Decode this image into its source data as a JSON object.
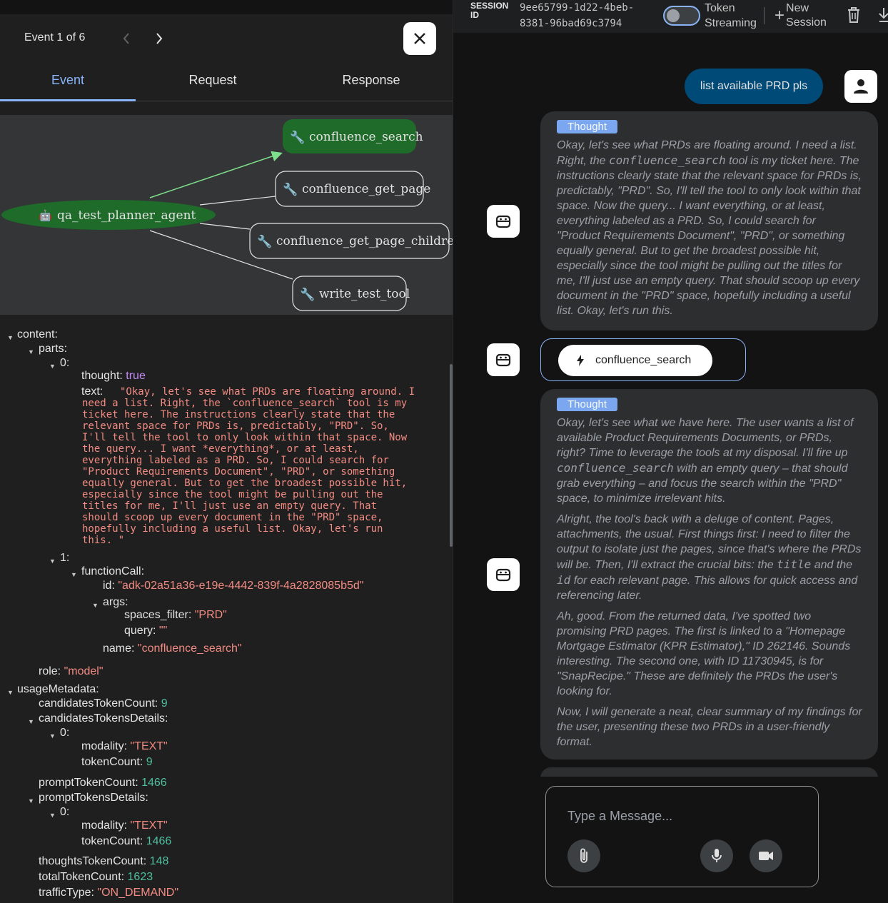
{
  "event_panel": {
    "event_nav": "Event 1 of 6",
    "tabs": [
      "Event",
      "Request",
      "Response"
    ],
    "graph": {
      "agent": "qa_test_planner_agent",
      "tools": [
        "confluence_search",
        "confluence_get_page",
        "confluence_get_page_children",
        "write_test_tool"
      ]
    },
    "json": {
      "content_key": "content:",
      "parts_key": "parts:",
      "idx0": "0:",
      "thought_key": "thought:",
      "thought_val": "true",
      "text_key": "text:",
      "text_lines": [
        "\"Okay, let's see what PRDs are floating around. I",
        "need a list. Right, the `confluence_search` tool is my",
        "ticket here. The instructions clearly state that the",
        "relevant space for PRDs is, predictably, \"PRD\". So,",
        "I'll tell the tool to only look within that space. Now",
        "the query... I want *everything*, or at least,",
        "everything labeled as a PRD. So, I could search for",
        "\"Product Requirements Document\", \"PRD\", or something",
        "equally general. But to get the broadest possible hit,",
        "especially since the tool might be pulling out the",
        "titles for me, I'll just use an empty query. That",
        "should scoop up every document in the \"PRD\" space,",
        "hopefully including a useful list. Okay, let's run",
        "this. \""
      ],
      "idx1": "1:",
      "function_call_key": "functionCall:",
      "id_key": "id:",
      "id_val": "\"adk-02a51a36-e19e-4442-839f-4a2828085b5d\"",
      "args_key": "args:",
      "spaces_filter_key": "spaces_filter:",
      "spaces_filter_val": "\"PRD\"",
      "query_key": "query:",
      "query_val": "\"\"",
      "name_key": "name:",
      "name_val": "\"confluence_search\"",
      "role_key": "role:",
      "role_val": "\"model\"",
      "usage_key": "usageMetadata:",
      "cand_count_key": "candidatesTokenCount:",
      "cand_count_val": "9",
      "cand_details_key": "candidatesTokensDetails:",
      "cd_idx": "0:",
      "cd_modality_key": "modality:",
      "cd_modality_val": "\"TEXT\"",
      "cd_token_key": "tokenCount:",
      "cd_token_val": "9",
      "prompt_count_key": "promptTokenCount:",
      "prompt_count_val": "1466",
      "prompt_details_key": "promptTokensDetails:",
      "pd_idx": "0:",
      "pd_modality_key": "modality:",
      "pd_modality_val": "\"TEXT\"",
      "pd_token_key": "tokenCount:",
      "pd_token_val": "1466",
      "thoughts_key": "thoughtsTokenCount:",
      "thoughts_val": "148",
      "total_key": "totalTokenCount:",
      "total_val": "1623",
      "traffic_key": "trafficType:",
      "traffic_val": "\"ON_DEMAND\""
    }
  },
  "chat_panel": {
    "session_label_1": "SESSION",
    "session_label_2": "ID",
    "session_id_1": "9ee65799-1d22-4beb-",
    "session_id_2": "8381-96bad69c3794",
    "token_streaming_1": "Token",
    "token_streaming_2": "Streaming",
    "new_session_1": "New",
    "new_session_2": "Session",
    "user_message": "list available PRD pls",
    "thought_label": "Thought",
    "thought1": {
      "t1": "Okay, let's see what PRDs are floating around. I need a list. Right, the ",
      "code1": "confluence_search",
      "t2": " tool is my ticket here. The instructions clearly state that the relevant space for PRDs is, predictably, \"PRD\". So, I'll tell the tool to only look within that space. Now the query... I want everything, or at least, everything labeled as a PRD. So, I could search for \"Product Requirements Document\", \"PRD\", or something equally general. But to get the broadest possible hit, especially since the tool might be pulling out the titles for me, I'll just use an empty query. That should scoop up every document in the \"PRD\" space, hopefully including a useful list. Okay, let's run this."
    },
    "function_call_chip": "confluence_search",
    "thought2": {
      "p1a": "Okay, let's see what we have here. The user wants a list of available Product Requirements Documents, or PRDs, right? Time to leverage the tools at my disposal. I'll fire up ",
      "p1code": "confluence_search",
      "p1b": " with an empty query – that should grab everything – and focus the search within the \"PRD\" space, to minimize irrelevant hits.",
      "p2a": "Alright, the tool's back with a deluge of content. Pages, attachments, the usual. First things first: I need to filter the output to isolate just the pages, since that's where the PRDs will be. Then, I'll extract the crucial bits: the ",
      "p2code1": "title",
      "p2b": " and the ",
      "p2code2": "id",
      "p2c": " for each relevant page. This allows for quick access and referencing later.",
      "p3": "Ah, good. From the returned data, I've spotted two promising PRD pages. The first is linked to a \"Homepage Mortgage Estimator (KPR Estimator),\" ID 262146. Sounds interesting. The second one, with ID 11730945, is for \"SnapRecipe.\" These are definitely the PRDs the user's looking for.",
      "p4": "Now, I will generate a neat, clear summary of my findings for the user, presenting these two PRDs in a user-friendly format."
    },
    "input_placeholder": "Type a Message..."
  }
}
